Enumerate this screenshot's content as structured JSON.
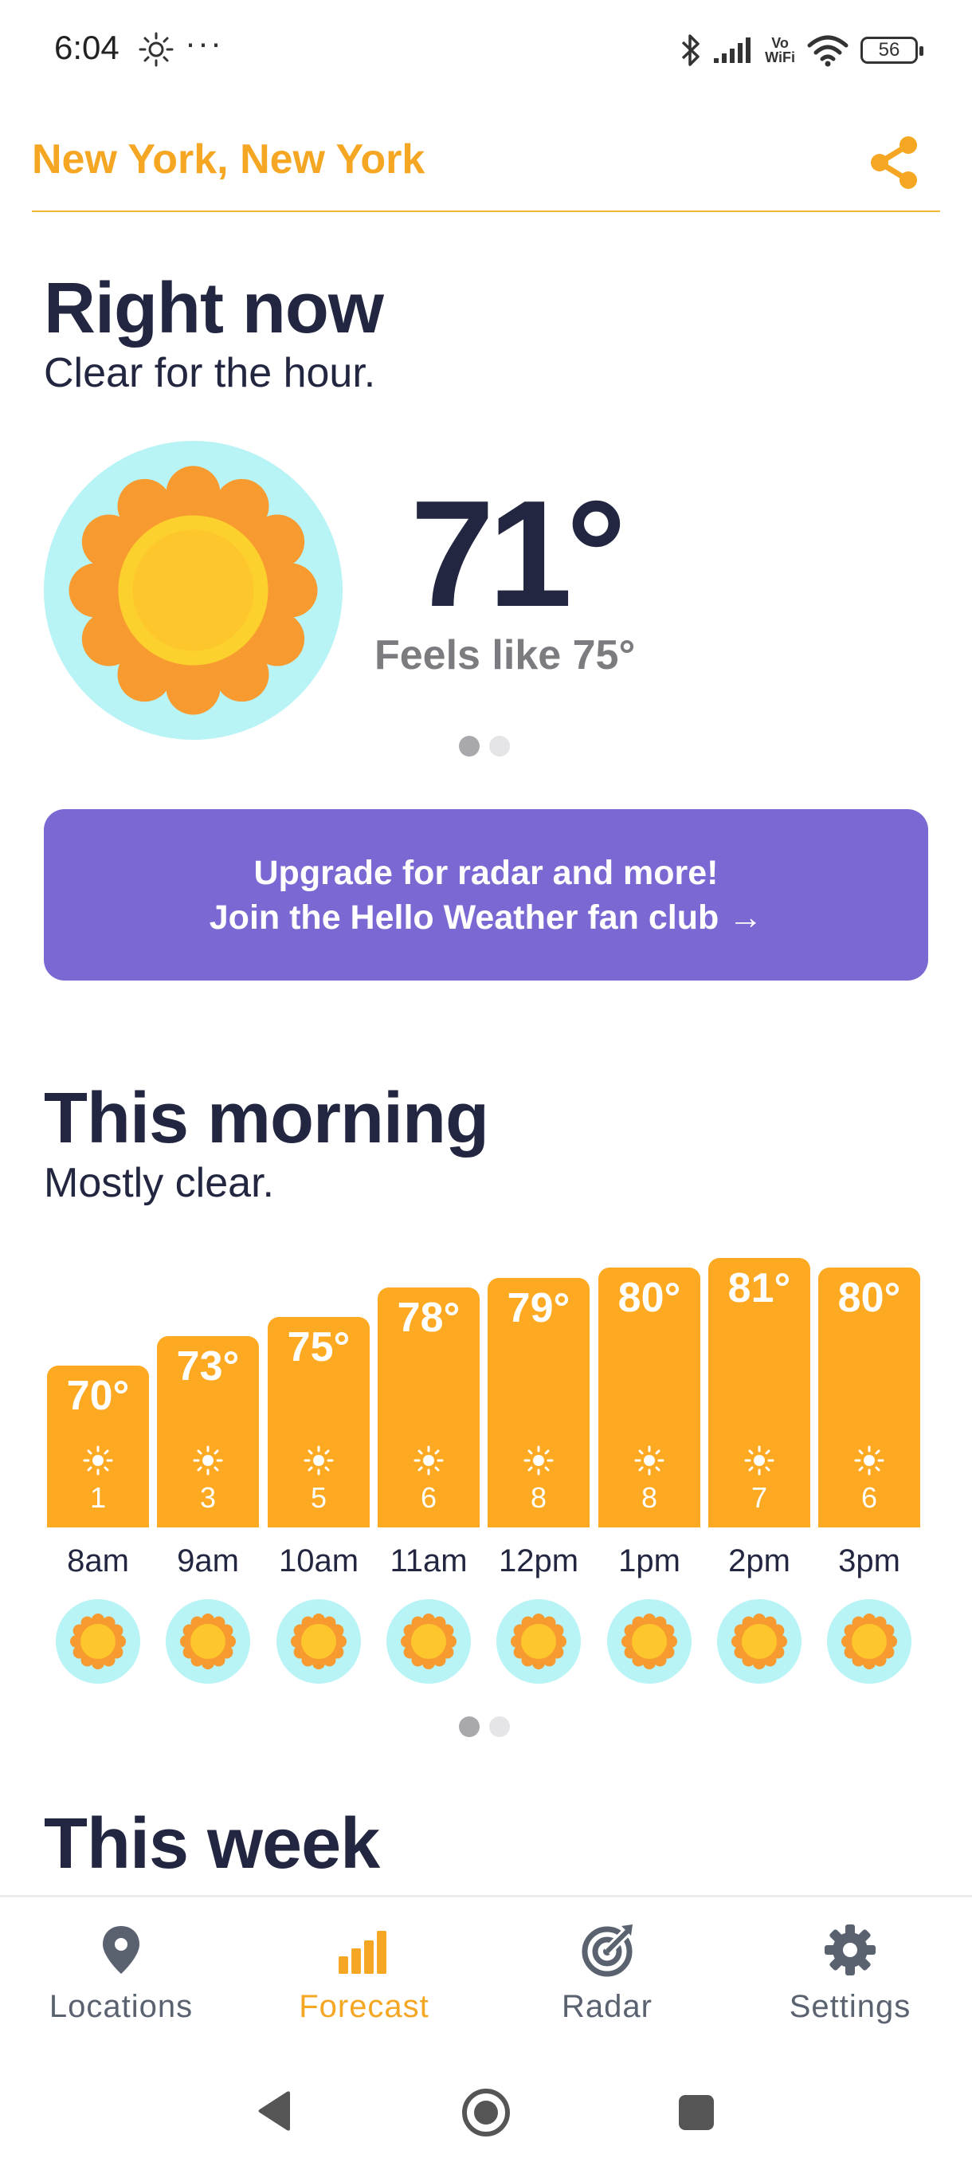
{
  "status_bar": {
    "time": "6:04",
    "dots": "···",
    "battery": "56",
    "vowifi_top": "Vo",
    "vowifi_bottom": "WiFi"
  },
  "header": {
    "location": "New York, New York"
  },
  "right_now": {
    "title": "Right now",
    "subtitle": "Clear for the hour.",
    "temperature": "71°",
    "feels_like": "Feels like 75°"
  },
  "upgrade": {
    "line1": "Upgrade for radar and more!",
    "line2": "Join the Hello Weather fan club →"
  },
  "morning": {
    "title": "This morning",
    "subtitle": "Mostly clear.",
    "hours": [
      {
        "time": "8am",
        "temp": "70°",
        "temp_value": 70,
        "uv": "1"
      },
      {
        "time": "9am",
        "temp": "73°",
        "temp_value": 73,
        "uv": "3"
      },
      {
        "time": "10am",
        "temp": "75°",
        "temp_value": 75,
        "uv": "5"
      },
      {
        "time": "11am",
        "temp": "78°",
        "temp_value": 78,
        "uv": "6"
      },
      {
        "time": "12pm",
        "temp": "79°",
        "temp_value": 79,
        "uv": "8"
      },
      {
        "time": "1pm",
        "temp": "80°",
        "temp_value": 80,
        "uv": "8"
      },
      {
        "time": "2pm",
        "temp": "81°",
        "temp_value": 81,
        "uv": "7"
      },
      {
        "time": "3pm",
        "temp": "80°",
        "temp_value": 80,
        "uv": "6"
      }
    ]
  },
  "week": {
    "title": "This week"
  },
  "nav": {
    "items": [
      {
        "label": "Locations",
        "icon": "map-pin-icon",
        "active": false
      },
      {
        "label": "Forecast",
        "icon": "bar-chart-icon",
        "active": true
      },
      {
        "label": "Radar",
        "icon": "radar-icon",
        "active": false
      },
      {
        "label": "Settings",
        "icon": "gear-icon",
        "active": false
      }
    ]
  },
  "colors": {
    "accent": "#f5a623",
    "bar": "#fda921",
    "banner": "#7b68d3",
    "text": "#222640",
    "sky": "#b8f3f6"
  }
}
